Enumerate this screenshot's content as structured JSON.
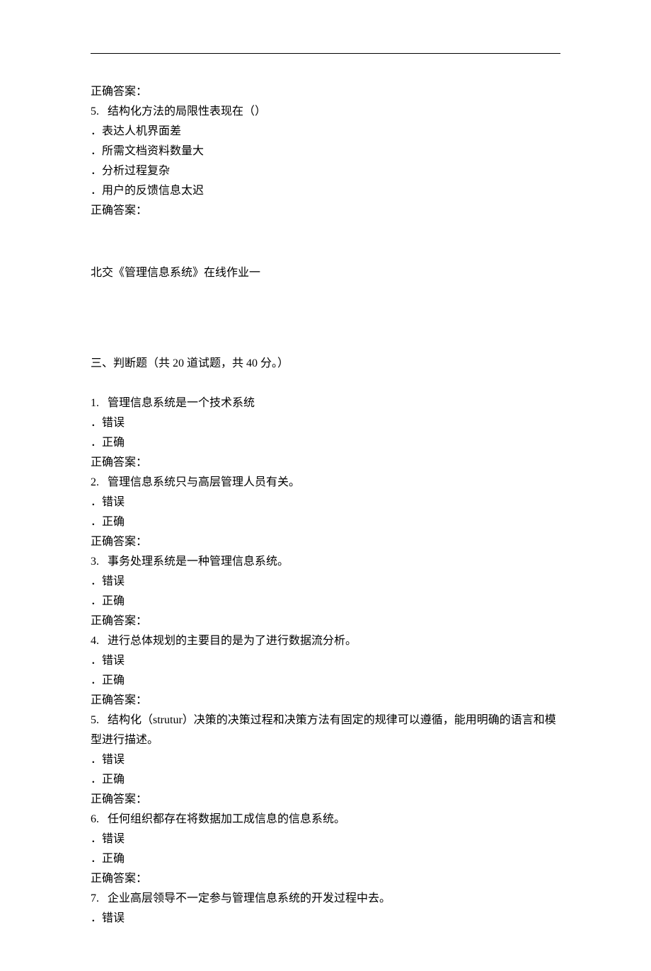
{
  "prev_answer_label": "正确答案：",
  "mc_q5": {
    "num": "5.",
    "text": "结构化方法的局限性表现在（）",
    "opts": [
      "表达人机界面差",
      "所需文档资料数量大",
      "分析过程复杂",
      "用户的反馈信息太迟"
    ],
    "answer_label": "正确答案："
  },
  "title": "北交《管理信息系统》在线作业一",
  "section3": "三、判断题（共 20 道试题，共 40 分。）",
  "tf": [
    {
      "num": "1.",
      "text": "管理信息系统是一个技术系统",
      "optA": "错误",
      "optB": "正确",
      "answer_label": "正确答案："
    },
    {
      "num": "2.",
      "text": "管理信息系统只与高层管理人员有关。",
      "optA": "错误",
      "optB": "正确",
      "answer_label": "正确答案："
    },
    {
      "num": "3.",
      "text": "事务处理系统是一种管理信息系统。",
      "optA": "错误",
      "optB": "正确",
      "answer_label": "正确答案："
    },
    {
      "num": "4.",
      "text": "进行总体规划的主要目的是为了进行数据流分析。",
      "optA": "错误",
      "optB": "正确",
      "answer_label": "正确答案："
    },
    {
      "num": "5.",
      "text": "结构化（strutur）决策的决策过程和决策方法有固定的规律可以遵循，能用明确的语言和模型进行描述。",
      "optA": "错误",
      "optB": "正确",
      "answer_label": "正确答案："
    },
    {
      "num": "6.",
      "text": "任何组织都存在将数据加工成信息的信息系统。",
      "optA": "错误",
      "optB": "正确",
      "answer_label": "正确答案："
    },
    {
      "num": "7.",
      "text": "企业高层领导不一定参与管理信息系统的开发过程中去。",
      "optA": "错误",
      "optB": null,
      "answer_label": null
    }
  ]
}
